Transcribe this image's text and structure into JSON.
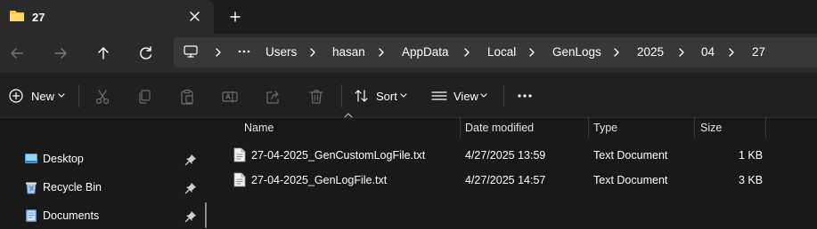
{
  "tab": {
    "title": "27"
  },
  "breadcrumb": [
    "Users",
    "hasan",
    "AppData",
    "Local",
    "GenLogs",
    "2025",
    "04",
    "27"
  ],
  "commands": {
    "new_label": "New",
    "sort_label": "Sort",
    "view_label": "View"
  },
  "sidebar": {
    "items": [
      {
        "label": "Desktop",
        "icon": "desktop-icon",
        "pinned": true
      },
      {
        "label": "Recycle Bin",
        "icon": "recycle-bin-icon",
        "pinned": true
      },
      {
        "label": "Documents",
        "icon": "documents-icon",
        "pinned": true
      }
    ]
  },
  "columns": {
    "name": "Name",
    "date": "Date modified",
    "type": "Type",
    "size": "Size"
  },
  "files": [
    {
      "name": "27-04-2025_GenCustomLogFile.txt",
      "date": "4/27/2025 13:59",
      "type": "Text Document",
      "size": "1 KB"
    },
    {
      "name": "27-04-2025_GenLogFile.txt",
      "date": "4/27/2025 14:57",
      "type": "Text Document",
      "size": "3 KB"
    }
  ],
  "colors": {
    "accent": "#ffc83d",
    "background": "#191919",
    "tab": "#2b2b2b",
    "address_bar": "#383838"
  }
}
